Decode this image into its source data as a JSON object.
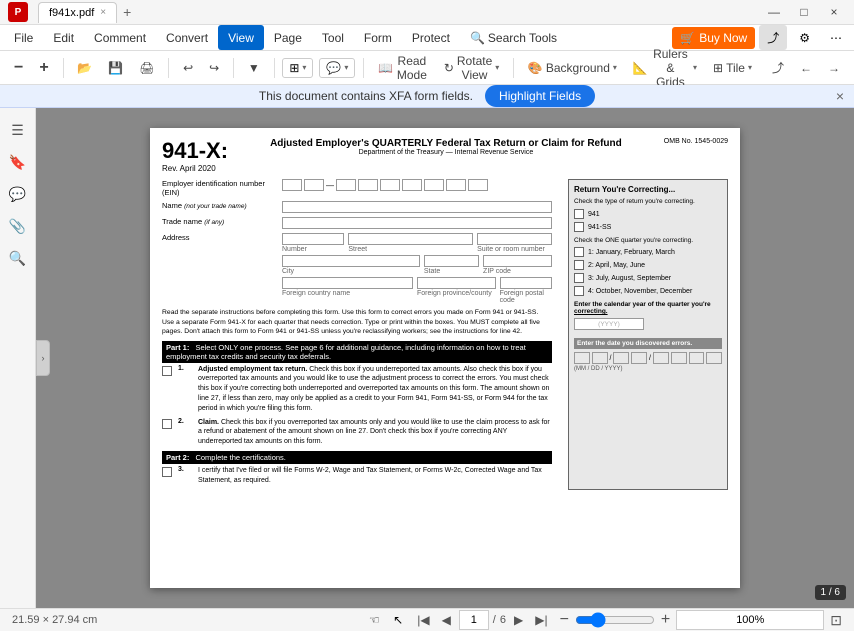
{
  "titleBar": {
    "appName": "f941x.pdf",
    "closeTab": "×",
    "newTab": "+",
    "minimize": "—",
    "maximize": "□",
    "close": "×"
  },
  "menuBar": {
    "items": [
      {
        "label": "File",
        "active": false
      },
      {
        "label": "Edit",
        "active": false
      },
      {
        "label": "Comment",
        "active": false
      },
      {
        "label": "Convert",
        "active": false
      },
      {
        "label": "View",
        "active": true
      },
      {
        "label": "Page",
        "active": false
      },
      {
        "label": "Tool",
        "active": false
      },
      {
        "label": "Form",
        "active": false
      },
      {
        "label": "Protect",
        "active": false
      },
      {
        "label": "Search Tools",
        "active": false
      }
    ],
    "buyNow": "🛒 Buy Now",
    "toolbar": {
      "undo": "↩",
      "redo": "↪",
      "print": "🖨",
      "open": "📂",
      "save": "💾",
      "readMode": "Read Mode",
      "rotateView": "Rotate View",
      "background": "Background",
      "rulersGrids": "Rulers & Grids",
      "tile": "Tile",
      "zoomOut": "⊖",
      "zoomIn": "⊕"
    }
  },
  "toolbar": {
    "zoomOut": "−",
    "zoomIn": "+",
    "readMode": "Read Mode",
    "rotateView": "Rotate View",
    "background": "Background",
    "rulersGrids": "Rulers & Grids",
    "tile": "Tile"
  },
  "infoBar": {
    "message": "This document contains XFA form fields.",
    "highlightBtn": "Highlight Fields",
    "close": "×"
  },
  "sidebar": {
    "icons": [
      "☰",
      "🔖",
      "💬",
      "📎",
      "🔍"
    ]
  },
  "form": {
    "number": "941-X:",
    "subtitle": "Rev. April 2020",
    "title": "Adjusted Employer's QUARTERLY Federal Tax Return or Claim for Refund",
    "dept": "Department of the Treasury — Internal Revenue Service",
    "omb": "OMB No. 1545-0029",
    "einLabel": "Employer identification number",
    "einSub": "(EIN)",
    "nameLabel": "Name",
    "nameSubLabel": "(not your trade name)",
    "tradeNameLabel": "Trade name",
    "tradeNameSub": "(if any)",
    "addressLabel": "Address",
    "addrFields": [
      "Number",
      "Street",
      "Suite or room number"
    ],
    "addrFields2": [
      "City",
      "State",
      "ZIP code"
    ],
    "addrFields3": [
      "Foreign country name",
      "Foreign province/county",
      "Foreign postal code"
    ],
    "rightPanel": {
      "title": "Return You're Correcting...",
      "subtitle": "Check the type of return you're correcting.",
      "options": [
        "941",
        "941-SS"
      ],
      "quarterTitle": "Check the ONE quarter you're correcting.",
      "quarters": [
        "1: January, February, March",
        "2: April, May, June",
        "3: July, August, September",
        "4: October, November, December"
      ],
      "calendarYear": "Enter the calendar year of the quarter you're correcting.",
      "calendarYYYY": "(YYYY)",
      "discoveredTitle": "Enter the date you discovered errors.",
      "dateFormat": "(MM / DD / YYYY)"
    },
    "instructions": "Read the separate instructions before completing this form. Use this form to correct errors you made on Form 941 or 941-SS. Use a separate Form 941-X for each quarter that needs correction. Type or print within the boxes. You MUST complete all five pages. Don't attach this form to Form 941 or 941-SS unless you're reclassifying workers; see the instructions for line 42.",
    "part1Header": "Part 1:",
    "part1Title": "Select ONLY one process. See page 6 for additional guidance, including information on how to treat employment tax credits and security tax deferrals.",
    "items": [
      {
        "num": "1.",
        "boldLabel": "Adjusted employment tax return.",
        "text": "Check this box if you underreported tax amounts. Also check this box if you overreported tax amounts and you would like to use the adjustment process to correct the errors. You must check this box if you're correcting both underreported and overreported tax amounts on this form. The amount shown on line 27, if less than zero, may only be applied as a credit to your Form 941, Form 941-SS, or Form 944 for the tax period in which you're filing this form."
      },
      {
        "num": "2.",
        "boldLabel": "Claim.",
        "text": "Check this box if you overreported tax amounts only and you would like to use the claim process to ask for a refund or abatement of the amount shown on line 27. Don't check this box if you're correcting ANY underreported tax amounts on this form."
      }
    ],
    "part2Header": "Part 2:",
    "part2Title": "Complete the certifications.",
    "part2Items": [
      {
        "num": "3.",
        "boldLabel": "I certify that I've filed or will file Forms W-2, Wage and Tax Statement, or Forms W-2c, Corrected Wage and Tax Statement, as required."
      }
    ]
  },
  "statusBar": {
    "dimensions": "21.59 × 27.94 cm",
    "currentPage": "1",
    "totalPages": "6",
    "pageBadge": "1 / 6",
    "zoomLevel": "100%"
  }
}
